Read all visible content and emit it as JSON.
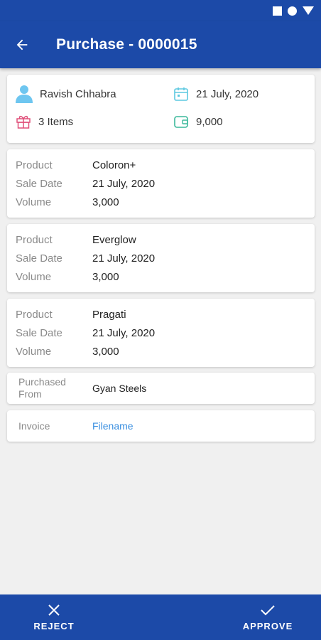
{
  "header": {
    "title": "Purchase - 0000015"
  },
  "summary": {
    "customer": "Ravish Chhabra",
    "date": "21 July, 2020",
    "items": "3 Items",
    "amount": "9,000"
  },
  "products": [
    {
      "product_label": "Product",
      "product": "Coloron+",
      "date_label": "Sale Date",
      "date": "21 July, 2020",
      "volume_label": "Volume",
      "volume": "3,000"
    },
    {
      "product_label": "Product",
      "product": "Everglow",
      "date_label": "Sale Date",
      "date": "21 July, 2020",
      "volume_label": "Volume",
      "volume": "3,000"
    },
    {
      "product_label": "Product",
      "product": "Pragati",
      "date_label": "Sale Date",
      "date": "21 July, 2020",
      "volume_label": "Volume",
      "volume": "3,000"
    }
  ],
  "purchased_from": {
    "label_line1": "Purchased",
    "label_line2": "From",
    "value": "Gyan Steels"
  },
  "invoice": {
    "label": "Invoice",
    "value": "Filename"
  },
  "actions": {
    "reject": "REJECT",
    "approve": "APPROVE"
  },
  "icons": {
    "back": "arrow-left-icon",
    "person": "person-icon",
    "calendar": "calendar-icon",
    "gift": "gift-icon",
    "wallet": "wallet-icon",
    "reject": "close-icon",
    "approve": "check-icon"
  },
  "colors": {
    "primary": "#1c4aa8",
    "link": "#3a8fe0",
    "person": "#6ec6f0",
    "gift": "#e0507a",
    "calendar": "#5cc8e0",
    "wallet": "#3ab89a"
  }
}
